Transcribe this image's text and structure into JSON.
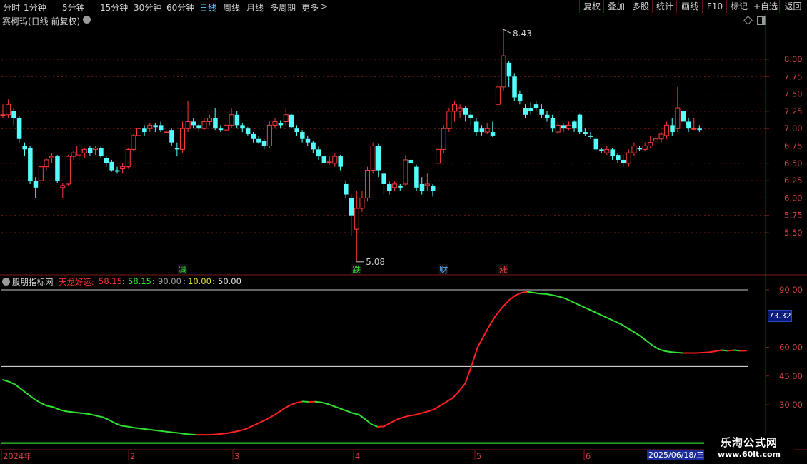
{
  "toolbar": {
    "periods": [
      "分时",
      "1分钟",
      "5分钟",
      "15分钟",
      "30分钟",
      "60分钟",
      "日线",
      "周线",
      "月线",
      "多周期",
      "更多"
    ],
    "more_arrow": ">",
    "active_period": "日线",
    "right_buttons": [
      "复权",
      "叠加",
      "多股",
      "统计",
      "画线",
      "F10",
      "标记",
      "+自选",
      "返回"
    ]
  },
  "stock": {
    "name": "赛柯玛",
    "mode": "(日线 前复权)"
  },
  "price_axis": {
    "ticks": [
      "8.00",
      "7.75",
      "7.50",
      "7.25",
      "7.00",
      "6.75",
      "6.50",
      "6.25",
      "6.00",
      "5.75",
      "5.50"
    ]
  },
  "annotations": {
    "high_label": "8.43",
    "low_label": "5.08",
    "markers": [
      {
        "text": "减",
        "color": "#30d030"
      },
      {
        "text": "跌",
        "color": "#30d030"
      },
      {
        "text": "财",
        "color": "#5fb0ff"
      },
      {
        "text": "涨",
        "color": "#ff4040"
      }
    ]
  },
  "indicator": {
    "source": "股朋指标网",
    "name": "天龙好运:",
    "v1": "58.15",
    "sep": ":",
    "v2": "58.15",
    "v3": "90.00",
    "v4": "10.00",
    "v5": "50.00",
    "current_value": "73.32",
    "axis_ticks": [
      "90.00",
      "60.00",
      "45.00",
      "30.00"
    ]
  },
  "date_axis": {
    "labels": [
      "2024年",
      "2",
      "3",
      "4",
      "5",
      "6"
    ],
    "current_date": "2025/06/18/三"
  },
  "watermark": {
    "line1": "乐淘公式网",
    "line2": "www.60lt.com"
  },
  "colors": {
    "up": "#ff3c3c",
    "down": "#54ffff",
    "grid": "#801818",
    "line_up": "#ff2020",
    "line_down": "#30e030"
  },
  "chart_data": {
    "type": "candlestick",
    "ylim": [
      5.05,
      8.45
    ],
    "candles": [
      [
        7.2,
        7.2,
        7.35,
        7.15
      ],
      [
        7.2,
        7.35,
        7.42,
        7.15
      ],
      [
        7.25,
        7.15,
        7.3,
        7.05
      ],
      [
        7.15,
        6.85,
        7.18,
        6.8
      ],
      [
        6.75,
        6.7,
        6.8,
        6.6
      ],
      [
        6.72,
        6.25,
        6.75,
        6.2
      ],
      [
        6.25,
        6.15,
        6.3,
        6.0
      ],
      [
        6.25,
        6.45,
        6.48,
        6.2
      ],
      [
        6.45,
        6.55,
        6.58,
        6.4
      ],
      [
        6.58,
        6.6,
        6.65,
        6.5
      ],
      [
        6.6,
        6.25,
        6.62,
        6.22
      ],
      [
        6.15,
        6.18,
        6.22,
        6.0
      ],
      [
        6.2,
        6.6,
        6.62,
        6.18
      ],
      [
        6.6,
        6.65,
        6.68,
        6.55
      ],
      [
        6.62,
        6.75,
        6.78,
        6.55
      ],
      [
        6.65,
        6.7,
        6.72,
        6.58
      ],
      [
        6.72,
        6.65,
        6.75,
        6.6
      ],
      [
        6.7,
        6.72,
        6.75,
        6.62
      ],
      [
        6.72,
        6.6,
        6.75,
        6.58
      ],
      [
        6.58,
        6.5,
        6.6,
        6.45
      ],
      [
        6.52,
        6.4,
        6.55,
        6.38
      ],
      [
        6.4,
        6.38,
        6.45,
        6.35
      ],
      [
        6.42,
        6.45,
        6.5,
        6.35
      ],
      [
        6.45,
        6.7,
        6.72,
        6.42
      ],
      [
        6.7,
        6.9,
        6.92,
        6.68
      ],
      [
        6.9,
        7.0,
        7.02,
        6.85
      ],
      [
        7.0,
        6.95,
        7.05,
        6.9
      ],
      [
        7.0,
        7.05,
        7.08,
        6.95
      ],
      [
        7.05,
        7.02,
        7.08,
        6.95
      ],
      [
        7.05,
        6.98,
        7.1,
        6.95
      ],
      [
        6.95,
        6.95,
        7.0,
        6.92
      ],
      [
        6.98,
        6.8,
        7.0,
        6.75
      ],
      [
        6.72,
        6.7,
        6.8,
        6.6
      ],
      [
        6.7,
        7.0,
        7.1,
        6.65
      ],
      [
        7.0,
        7.1,
        7.4,
        6.95
      ],
      [
        7.1,
        7.05,
        7.15,
        7.0
      ],
      [
        7.05,
        7.0,
        7.08,
        6.95
      ],
      [
        7.0,
        7.1,
        7.15,
        6.98
      ],
      [
        7.1,
        7.15,
        7.2,
        7.05
      ],
      [
        7.15,
        7.0,
        7.3,
        6.98
      ],
      [
        7.0,
        6.98,
        7.05,
        6.95
      ],
      [
        6.98,
        7.05,
        7.1,
        6.95
      ],
      [
        7.05,
        7.2,
        7.3,
        7.0
      ],
      [
        7.2,
        7.05,
        7.25,
        7.0
      ],
      [
        7.05,
        7.0,
        7.08,
        6.95
      ],
      [
        7.0,
        6.92,
        7.02,
        6.9
      ],
      [
        6.92,
        6.85,
        6.95,
        6.8
      ],
      [
        6.85,
        6.8,
        6.9,
        6.78
      ],
      [
        6.82,
        6.75,
        6.85,
        6.7
      ],
      [
        6.75,
        7.05,
        7.1,
        6.72
      ],
      [
        7.05,
        7.1,
        7.15,
        7.0
      ],
      [
        7.08,
        7.05,
        7.12,
        7.0
      ],
      [
        7.1,
        7.2,
        7.3,
        7.05
      ],
      [
        7.2,
        7.02,
        7.22,
        7.0
      ],
      [
        7.0,
        6.95,
        7.05,
        6.9
      ],
      [
        6.95,
        6.85,
        6.98,
        6.8
      ],
      [
        6.85,
        6.8,
        6.9,
        6.75
      ],
      [
        6.8,
        6.7,
        6.82,
        6.65
      ],
      [
        6.7,
        6.6,
        6.75,
        6.55
      ],
      [
        6.6,
        6.5,
        6.65,
        6.45
      ],
      [
        6.52,
        6.52,
        6.6,
        6.48
      ],
      [
        6.5,
        6.6,
        6.65,
        6.45
      ],
      [
        6.6,
        6.45,
        6.62,
        6.4
      ],
      [
        6.2,
        6.05,
        6.25,
        6.0
      ],
      [
        6.0,
        5.75,
        6.05,
        5.45
      ],
      [
        5.55,
        5.85,
        6.1,
        5.08
      ],
      [
        5.85,
        6.0,
        6.1,
        5.8
      ],
      [
        6.0,
        6.4,
        6.45,
        5.95
      ],
      [
        6.4,
        6.75,
        6.8,
        6.35
      ],
      [
        6.75,
        6.4,
        6.78,
        6.3
      ],
      [
        6.35,
        6.2,
        6.4,
        6.05
      ],
      [
        6.2,
        6.1,
        6.25,
        6.05
      ],
      [
        6.15,
        6.2,
        6.25,
        6.1
      ],
      [
        6.18,
        6.15,
        6.2,
        6.1
      ],
      [
        6.2,
        6.55,
        6.62,
        6.18
      ],
      [
        6.55,
        6.5,
        6.6,
        6.45
      ],
      [
        6.45,
        6.15,
        6.48,
        6.1
      ],
      [
        6.2,
        6.1,
        6.3,
        6.05
      ],
      [
        6.18,
        6.2,
        6.35,
        6.1
      ],
      [
        6.18,
        6.1,
        6.2,
        6.02
      ],
      [
        6.5,
        6.7,
        6.75,
        6.45
      ],
      [
        6.7,
        7.0,
        7.05,
        6.65
      ],
      [
        7.0,
        7.25,
        7.3,
        6.95
      ],
      [
        7.25,
        7.35,
        7.4,
        7.1
      ],
      [
        7.25,
        7.3,
        7.35,
        7.15
      ],
      [
        7.3,
        7.2,
        7.32,
        7.1
      ],
      [
        7.2,
        7.15,
        7.25,
        7.05
      ],
      [
        7.1,
        6.95,
        7.15,
        6.9
      ],
      [
        7.0,
        6.95,
        7.05,
        6.9
      ],
      [
        6.95,
        7.0,
        7.08,
        6.92
      ],
      [
        6.95,
        6.9,
        7.1,
        6.88
      ],
      [
        7.35,
        7.6,
        7.65,
        7.3
      ],
      [
        7.6,
        8.05,
        8.43,
        7.55
      ],
      [
        7.95,
        7.75,
        7.98,
        7.6
      ],
      [
        7.75,
        7.45,
        7.8,
        7.4
      ],
      [
        7.5,
        7.4,
        7.55,
        7.35
      ],
      [
        7.3,
        7.2,
        7.35,
        7.15
      ],
      [
        7.3,
        7.25,
        7.38,
        7.2
      ],
      [
        7.35,
        7.3,
        7.4,
        7.25
      ],
      [
        7.28,
        7.2,
        7.35,
        7.15
      ],
      [
        7.2,
        7.15,
        7.25,
        7.1
      ],
      [
        7.15,
        7.0,
        7.2,
        6.95
      ],
      [
        6.95,
        7.05,
        7.1,
        6.92
      ],
      [
        7.05,
        7.0,
        7.08,
        6.95
      ],
      [
        7.0,
        7.05,
        7.1,
        6.98
      ],
      [
        7.1,
        7.0,
        7.12,
        6.95
      ],
      [
        7.2,
        6.95,
        7.22,
        6.92
      ],
      [
        6.95,
        6.92,
        7.0,
        6.9
      ],
      [
        6.9,
        6.88,
        6.95,
        6.85
      ],
      [
        6.85,
        6.7,
        6.88,
        6.68
      ],
      [
        6.7,
        6.68,
        6.72,
        6.65
      ],
      [
        6.65,
        6.7,
        6.75,
        6.62
      ],
      [
        6.7,
        6.6,
        6.72,
        6.55
      ],
      [
        6.62,
        6.55,
        6.65,
        6.5
      ],
      [
        6.55,
        6.5,
        6.62,
        6.45
      ],
      [
        6.5,
        6.65,
        6.7,
        6.45
      ],
      [
        6.65,
        6.75,
        6.8,
        6.6
      ],
      [
        6.72,
        6.7,
        6.75,
        6.68
      ],
      [
        6.7,
        6.75,
        6.8,
        6.68
      ],
      [
        6.75,
        6.8,
        6.9,
        6.72
      ],
      [
        6.82,
        6.85,
        6.9,
        6.78
      ],
      [
        6.85,
        6.92,
        6.95,
        6.8
      ],
      [
        6.9,
        7.05,
        7.1,
        6.85
      ],
      [
        7.05,
        6.95,
        7.15,
        6.9
      ],
      [
        7.0,
        7.3,
        7.6,
        6.95
      ],
      [
        7.25,
        7.1,
        7.3,
        7.05
      ],
      [
        7.1,
        7.0,
        7.15,
        6.95
      ],
      [
        7.0,
        7.0,
        7.15,
        6.98
      ],
      [
        7.0,
        6.98,
        7.05,
        6.95
      ]
    ],
    "markers_x_days": [
      {
        "i": 33,
        "label": "减"
      },
      {
        "i": 65,
        "label": "跌"
      },
      {
        "i": 81,
        "label": "财"
      },
      {
        "i": 92,
        "label": "涨"
      }
    ],
    "indicator_ylim": [
      15,
      100
    ],
    "indicator_series": [
      43,
      42,
      40.5,
      38,
      35.5,
      33,
      31,
      29.5,
      28.8,
      27.5,
      26.6,
      26.2,
      25.8,
      25.5,
      25,
      24.2,
      23.5,
      22,
      20.3,
      19,
      18.6,
      18,
      17.6,
      17.2,
      16.8,
      16.4,
      16,
      15.6,
      15.3,
      14.8,
      14.5,
      14.3,
      14.3,
      14.3,
      14.5,
      14.8,
      15.2,
      15.8,
      16.5,
      17.5,
      19,
      20.5,
      22,
      23.8,
      25.8,
      28,
      29.8,
      31,
      31.7,
      31.5,
      31.6,
      31.2,
      30.4,
      29.2,
      28,
      26.8,
      25.6,
      24.8,
      22.4,
      19.8,
      18.5,
      18.7,
      20.5,
      22.2,
      23.3,
      24.2,
      24.7,
      25.6,
      26.5,
      27.5,
      29.5,
      31.5,
      33.5,
      37,
      41,
      50,
      60,
      66,
      72,
      77,
      81,
      84.5,
      87,
      88.5,
      89,
      88.5,
      88,
      87.8,
      87.2,
      86.5,
      85.5,
      84,
      82.5,
      81,
      79.5,
      78,
      76.5,
      75,
      73.5,
      72,
      70,
      68,
      66,
      63.5,
      61,
      59,
      58,
      57.5,
      57.2,
      57,
      57,
      57,
      57.2,
      57.4,
      57.9,
      58.5,
      58.2,
      58.5,
      58.2,
      58.2
    ],
    "reference_lines": [
      90,
      50,
      10
    ]
  }
}
